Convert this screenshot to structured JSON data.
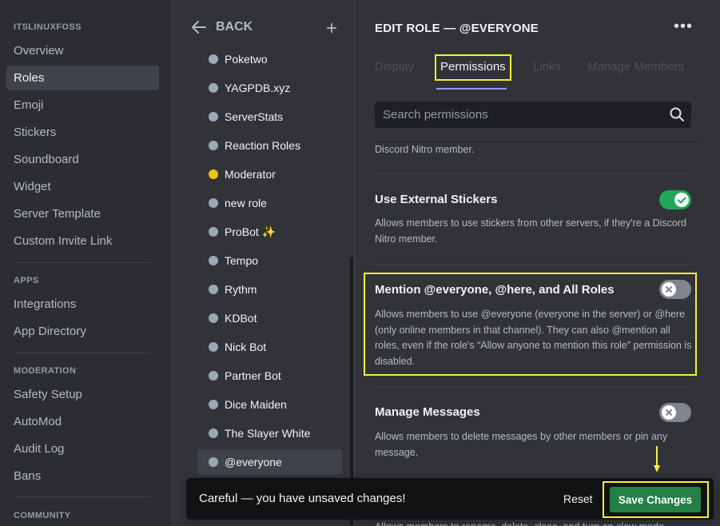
{
  "sidebar": {
    "server_header": "ITSLINUXFOSS",
    "items_top": [
      "Overview",
      "Roles",
      "Emoji",
      "Stickers",
      "Soundboard",
      "Widget",
      "Server Template",
      "Custom Invite Link"
    ],
    "apps_header": "APPS",
    "apps_items": [
      "Integrations",
      "App Directory"
    ],
    "moderation_header": "MODERATION",
    "moderation_items": [
      "Safety Setup",
      "AutoMod",
      "Audit Log",
      "Bans"
    ],
    "community_header": "COMMUNITY",
    "active_item": "Roles"
  },
  "roles_panel": {
    "back_label": "BACK",
    "roles": [
      {
        "name": "Poketwo",
        "color": "#99aab5"
      },
      {
        "name": "YAGPDB.xyz",
        "color": "#99aab5"
      },
      {
        "name": "ServerStats",
        "color": "#99aab5"
      },
      {
        "name": "Reaction Roles",
        "color": "#99aab5"
      },
      {
        "name": "Moderator",
        "color": "#f1c40f"
      },
      {
        "name": "new role",
        "color": "#99aab5"
      },
      {
        "name": "ProBot ✨",
        "color": "#99aab5"
      },
      {
        "name": "Tempo",
        "color": "#99aab5"
      },
      {
        "name": "Rythm",
        "color": "#99aab5"
      },
      {
        "name": "KDBot",
        "color": "#99aab5"
      },
      {
        "name": "Nick Bot",
        "color": "#99aab5"
      },
      {
        "name": "Partner Bot",
        "color": "#99aab5"
      },
      {
        "name": "Dice Maiden",
        "color": "#99aab5"
      },
      {
        "name": "The Slayer White",
        "color": "#99aab5"
      },
      {
        "name": "@everyone",
        "color": "#99aab5"
      }
    ],
    "selected_role": "@everyone"
  },
  "edit": {
    "title": "EDIT ROLE — @EVERYONE",
    "tabs": [
      "Display",
      "Permissions",
      "Links",
      "Manage Members"
    ],
    "active_tab": "Permissions",
    "search_placeholder": "Search permissions",
    "partial_top_desc": "Discord Nitro member.",
    "permissions": [
      {
        "title": "Use External Stickers",
        "desc": "Allows members to use stickers from other servers, if they're a Discord Nitro member.",
        "enabled": true
      },
      {
        "title": "Mention @everyone, @here, and All Roles",
        "desc": "Allows members to use @everyone (everyone in the server) or @here (only online members in that channel). They can also @mention all roles, even if the role's “Allow anyone to mention this role” permission is disabled.",
        "enabled": false
      },
      {
        "title": "Manage Messages",
        "desc": "Allows members to delete messages by other members or pin any message.",
        "enabled": false
      }
    ],
    "partial_bottom_desc": "Allows members to rename, delete, close, and turn on slow mode"
  },
  "unsaved_bar": {
    "text": "Careful — you have unsaved changes!",
    "reset_label": "Reset",
    "save_label": "Save Changes"
  },
  "colors": {
    "accent_highlight": "#f4f13c",
    "toggle_on": "#23a55a",
    "save_button": "#248046"
  }
}
